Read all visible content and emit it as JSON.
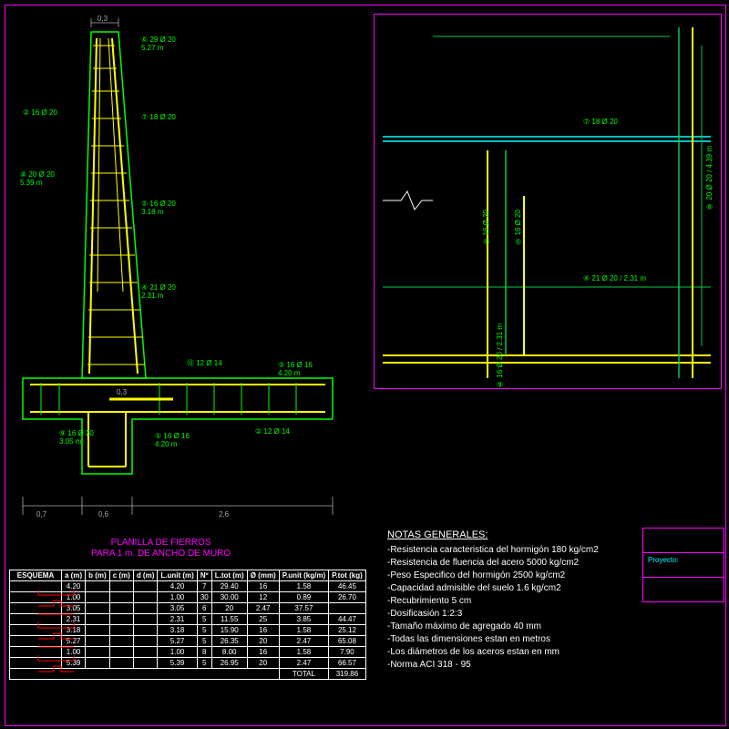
{
  "dims": {
    "top": "0,3",
    "wall_top1": "0,3",
    "bot_left": "0,7",
    "bot_mid": "0,6",
    "bot_right": "2,6"
  },
  "callouts": {
    "c1": {
      "t": "⑥ 29 Ø 20",
      "s": "5.27 m"
    },
    "c2": {
      "t": "② 16 Ø 20",
      "s": ""
    },
    "c3": {
      "t": "⑦ 18 Ø 20",
      "s": ""
    },
    "c4": {
      "t": "⑤ 16 Ø 20",
      "s": "3.18 m"
    },
    "c5": {
      "t": "⑧ 20 Ø 20",
      "s": "5.39 m"
    },
    "c6": {
      "t": "④ 21 Ø 20",
      "s": "2.31 m"
    },
    "c7": {
      "t": "⑫ 12 Ø 14",
      "s": ""
    },
    "c8": {
      "t": "③ 16 Ø 16",
      "s": "4.20 m"
    },
    "c9": {
      "t": "⑨ 16 Ø 20",
      "s": "3.05 m"
    },
    "c10": {
      "t": "① 16 Ø 16",
      "s": "4.20 m"
    },
    "c11": {
      "t": "② 12 Ø 14",
      "s": ""
    }
  },
  "right_callouts": {
    "r1": "⑦ 18 Ø 20",
    "r2": "② 16 Ø 20",
    "r3": "⑤ 16 Ø 20",
    "r4": "⑧ 20 Ø 20 / 4.39 m",
    "r5": "④ 21 Ø 20 / 2.31 m",
    "r6": "⑥ 16 Ø 20 / 2.31 m"
  },
  "table": {
    "title1": "PLANILLA DE FIERROS",
    "title2": "PARA 1 m. DE ANCHO DE MURO",
    "headers": [
      "ESQUEMA",
      "a (m)",
      "b (m)",
      "c (m)",
      "d (m)",
      "L.unit (m)",
      "Nº",
      "L.tot (m)",
      "Ø (mm)",
      "P.unit (kg/m)",
      "P.tot (kg)"
    ],
    "rows": [
      [
        "",
        "4.20",
        "",
        "",
        "",
        "4.20",
        "7",
        "29.40",
        "16",
        "1.58",
        "46.45"
      ],
      [
        "",
        "1.00",
        "",
        "",
        "",
        "1.00",
        "30",
        "30.00",
        "12",
        "0.89",
        "26.70"
      ],
      [
        "",
        "3.05",
        "",
        "",
        "",
        "3.05",
        "6",
        "20",
        "2.47",
        "37.57",
        ""
      ],
      [
        "",
        "2.31",
        "",
        "",
        "",
        "2.31",
        "5",
        "11.55",
        "25",
        "3.85",
        "44.47"
      ],
      [
        "",
        "3.18",
        "",
        "",
        "",
        "3.18",
        "5",
        "15.90",
        "16",
        "1.58",
        "25.12"
      ],
      [
        "",
        "5.27",
        "",
        "",
        "",
        "5.27",
        "5",
        "26.35",
        "20",
        "2.47",
        "65.08"
      ],
      [
        "",
        "1.00",
        "",
        "",
        "",
        "1.00",
        "8",
        "8.00",
        "16",
        "1.58",
        "7.90"
      ],
      [
        "",
        "5.39",
        "",
        "",
        "",
        "5.39",
        "5",
        "26.95",
        "20",
        "2.47",
        "66.57"
      ]
    ],
    "total_label": "TOTAL",
    "total": "319.86"
  },
  "notes": {
    "title": "NOTAS GENERALES:",
    "items": [
      "-Resistencia caracteristica del hormigón 180 kg/cm2",
      "-Resistencia de fluencia del acero 5000 kg/cm2",
      "-Peso Especifico del hormigón 2500 kg/cm2",
      "-Capacidad admisible del suelo 1.6 kg/cm2",
      "-Recubrimiento 5 cm",
      "-Dosificasión 1:2:3",
      "-Tamaño máximo de agregado 40 mm",
      "-Todas las dimensiones estan en metros",
      "-Los diámetros de los aceros estan en mm",
      "-Norma ACI 318 - 95"
    ]
  },
  "titleblock": {
    "row1": "",
    "row2": "Proyecto:",
    "row3": ""
  }
}
